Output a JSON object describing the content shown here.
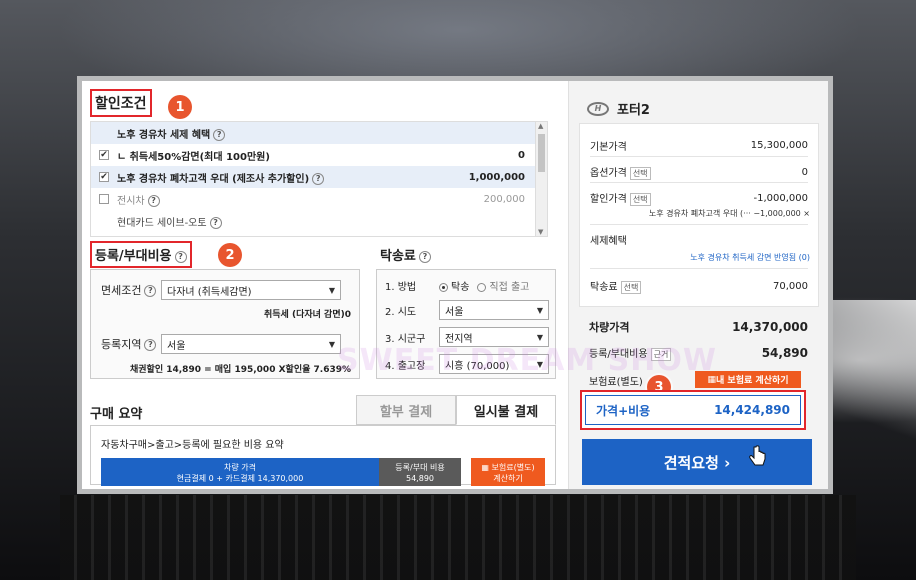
{
  "discount": {
    "title": "할인조건",
    "badge": "1",
    "rows": [
      {
        "label": "노후 경유차 세제 혜택",
        "amount": "",
        "checked": "",
        "highlight": true
      },
      {
        "label": "ㄴ 취득세50%감면(최대 100만원)",
        "amount": "0",
        "checked": "✔",
        "highlight": false
      },
      {
        "label": "노후 경유차 폐차고객 우대 (제조사 추가할인)",
        "amount": "1,000,000",
        "checked": "✔",
        "highlight": true
      },
      {
        "label": "전시차",
        "amount": "200,000",
        "checked": "",
        "highlight": false
      },
      {
        "label": "현대카드 세이브-오토",
        "amount": "",
        "checked": "",
        "highlight": false
      }
    ]
  },
  "registration": {
    "title": "등록/부대비용",
    "badge": "2",
    "exempt_label": "면세조건",
    "exempt_value": "다자녀 (취득세감면)",
    "exempt_note": "취득세 (다자녀 감면)0",
    "region_label": "등록지역",
    "region_value": "서울",
    "bond_note": "채권할인 14,890 = 매입 195,000 X할인율 7.639%"
  },
  "transport": {
    "title": "탁송료",
    "method_label": "1. 방법",
    "method_opt1": "탁송",
    "method_opt2": "직접 출고",
    "city_label": "2. 시도",
    "city_value": "서울",
    "district_label": "3. 시군구",
    "district_value": "전지역",
    "depot_label": "4. 출고장",
    "depot_value": "시흥 (70,000)"
  },
  "summary": {
    "title": "구매 요약",
    "tab_installment": "할부 결제",
    "tab_lump": "일시불 결제",
    "description": "자동차구매>출고>등록에 필요한 비용 요약",
    "car_price_label": "차량 가격",
    "car_price_detail": "현금결제 0 + 카드결제 14,370,000",
    "reg_label": "등록/부대 비용",
    "reg_value": "54,890",
    "ins_label": "보험료(별도)",
    "ins_sub": "계산하기"
  },
  "quote": {
    "model": "포터2",
    "base_label": "기본가격",
    "base_value": "15,300,000",
    "option_label": "옵션가격",
    "option_tag": "선택",
    "option_value": "0",
    "discount_label": "할인가격",
    "discount_tag": "선택",
    "discount_value": "-1,000,000",
    "discount_detail": "노후 경유차 폐차고객 우대 (··· −1,000,000 ×",
    "tax_label": "세제혜택",
    "tax_link": "노후 경유차 취득세 감면 반영됨 (0)",
    "transport_label": "탁송료",
    "transport_tag": "선택",
    "transport_value": "70,000",
    "car_price_label": "차량가격",
    "car_price_value": "14,370,000",
    "reg_label": "등록/부대비용",
    "reg_tag": "근거",
    "reg_value": "54,890",
    "ins_label": "보험료(별도)",
    "ins_button": "내 보험료 계산하기",
    "total_badge": "3",
    "total_label": "가격+비용",
    "total_value": "14,424,890",
    "request_button": "견적요청 ›"
  },
  "watermark": "SWEET DREAM SHOW",
  "colors": {
    "accent": "#1d63c5",
    "highlight_red": "#e2262b",
    "orange": "#ef5a1f"
  }
}
